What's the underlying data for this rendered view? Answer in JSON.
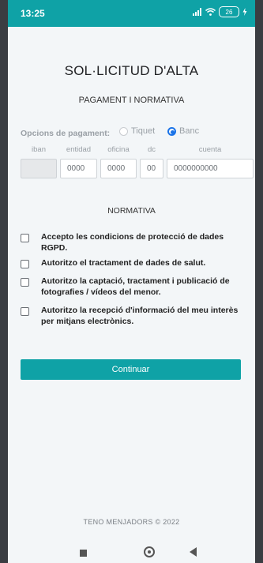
{
  "status_bar": {
    "time": "13:25",
    "battery": "26"
  },
  "form": {
    "title": "SOL·LICITUD D'ALTA",
    "subtitle": "PAGAMENT I NORMATIVA",
    "payment_label": "Opcions de pagament:",
    "payment_options": [
      {
        "label": "Tiquet",
        "selected": false
      },
      {
        "label": "Banc",
        "selected": true
      }
    ],
    "bank_headers": [
      "iban",
      "entidad",
      "oficina",
      "dc",
      "cuenta"
    ],
    "bank_fields": {
      "iban": "",
      "entidad": "0000",
      "oficina": "0000",
      "dc": "00",
      "cuenta": "0000000000"
    },
    "normativa_heading": "NORMATIVA",
    "checkboxes": [
      {
        "label": "Accepto les condicions de protecció de dades RGPD.",
        "checked": false
      },
      {
        "label": "Autoritzo el tractament de dades de salut.",
        "checked": false
      },
      {
        "label": "Autoritzo la captació, tractament i publicació de fotografies / vídeos del menor.",
        "checked": false
      },
      {
        "label": "Autoritzo la recepció d'informació del meu interès per mitjans electrònics.",
        "checked": false
      }
    ],
    "continue_label": "Continuar"
  },
  "footer": "TENO MENJADORS © 2022",
  "colors": {
    "accent": "#0fa2a6",
    "radio_selected": "#1a73e8"
  }
}
